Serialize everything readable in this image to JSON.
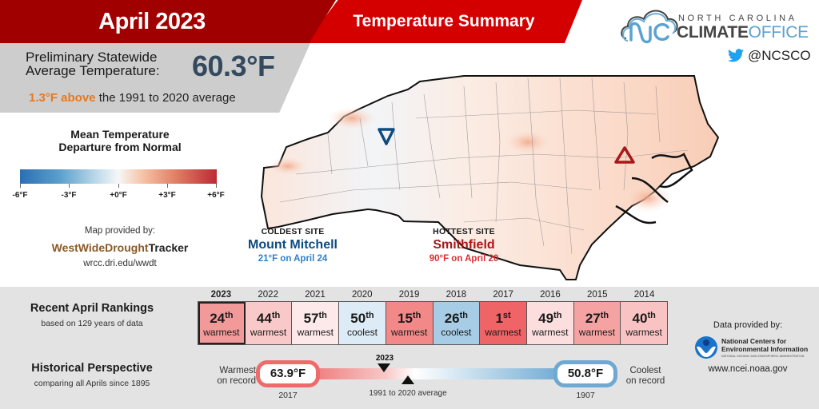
{
  "header": {
    "month_title": "April 2023",
    "summary_title": "Temperature Summary"
  },
  "statewide": {
    "label_line1": "Preliminary Statewide",
    "label_line2": "Average Temperature:",
    "value": "60.3°F",
    "departure_highlight": "1.3°F above",
    "departure_rest": " the 1991 to 2020 average"
  },
  "logo": {
    "line1": "NORTH CAROLINA",
    "line2_bold": "CLIMATE",
    "line2_light": "OFFICE",
    "twitter_handle": "@NCSCO"
  },
  "legend": {
    "title_line1": "Mean Temperature",
    "title_line2": "Departure from Normal",
    "ticks": [
      "-6°F",
      "-3°F",
      "+0°F",
      "+3°F",
      "+6°F"
    ],
    "colors": {
      "cold": "#2b6fb4",
      "neutral": "#f7f7f7",
      "warm": "#bc2a35"
    }
  },
  "map_credit": {
    "line1": "Map provided by:",
    "brand_part1": "WestWideDrought",
    "brand_part2": "Tracker",
    "url": "wrcc.dri.edu/wwdt"
  },
  "sites": {
    "coldest": {
      "label": "COLDEST SITE",
      "name": "Mount Mitchell",
      "detail": "21°F on April 24",
      "icon": "down-triangle-icon",
      "color": "#0d4c80"
    },
    "hottest": {
      "label": "HOTTEST SITE",
      "name": "Smithfield",
      "detail": "90°F on April 20",
      "icon": "up-triangle-icon",
      "color": "#a81818"
    }
  },
  "rankings": {
    "title": "Recent April Rankings",
    "subtitle": "based on 129 years of data",
    "items": [
      {
        "year": "2023",
        "rank": "24",
        "suffix": "th",
        "kind": "warmest",
        "color": "#f29a9a",
        "current": true
      },
      {
        "year": "2022",
        "rank": "44",
        "suffix": "th",
        "kind": "warmest",
        "color": "#f9c9c9",
        "current": false
      },
      {
        "year": "2021",
        "rank": "57",
        "suffix": "th",
        "kind": "warmest",
        "color": "#fde9e9",
        "current": false
      },
      {
        "year": "2020",
        "rank": "50",
        "suffix": "th",
        "kind": "coolest",
        "color": "#dcebf5",
        "current": false
      },
      {
        "year": "2019",
        "rank": "15",
        "suffix": "th",
        "kind": "warmest",
        "color": "#f28888",
        "current": false
      },
      {
        "year": "2018",
        "rank": "26",
        "suffix": "th",
        "kind": "coolest",
        "color": "#a7cde6",
        "current": false
      },
      {
        "year": "2017",
        "rank": "1",
        "suffix": "st",
        "kind": "warmest",
        "color": "#ef6466",
        "current": false
      },
      {
        "year": "2016",
        "rank": "49",
        "suffix": "th",
        "kind": "warmest",
        "color": "#fcdede",
        "current": false
      },
      {
        "year": "2015",
        "rank": "27",
        "suffix": "th",
        "kind": "warmest",
        "color": "#f4a2a2",
        "current": false
      },
      {
        "year": "2014",
        "rank": "40",
        "suffix": "th",
        "kind": "warmest",
        "color": "#f9c3c3",
        "current": false
      }
    ]
  },
  "historical": {
    "title": "Historical Perspective",
    "subtitle": "comparing all Aprils since 1895",
    "warmest": {
      "label_line1": "Warmest",
      "label_line2": "on record",
      "value": "63.9°F",
      "year": "2017"
    },
    "coolest": {
      "label_line1": "Coolest",
      "label_line2": "on record",
      "value": "50.8°F",
      "year": "1907"
    },
    "current_marker_label": "2023",
    "average_marker_label": "1991 to 2020 average"
  },
  "data_credit": {
    "line1": "Data provided by:",
    "org_line1": "National Centers for",
    "org_line2": "Environmental Information",
    "org_sub": "NATIONAL OCEANIC AND ATMOSPHERIC ADMINISTRATION",
    "url": "www.ncei.noaa.gov"
  }
}
